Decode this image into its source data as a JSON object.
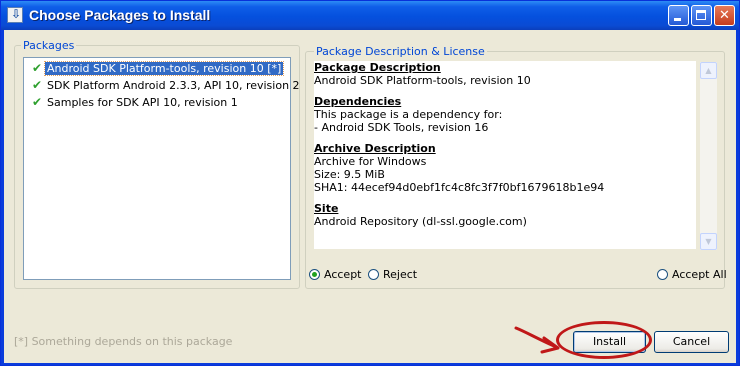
{
  "window": {
    "title": "Choose Packages to Install",
    "icon": "download-arrow-icon",
    "controls": [
      "minimize-icon",
      "maximize-icon",
      "close-icon"
    ]
  },
  "packages": {
    "legend": "Packages",
    "items": [
      {
        "label": "Android SDK Platform-tools, revision 10 [*]",
        "status_icon": "green-check-icon",
        "selected": true
      },
      {
        "label": "SDK Platform Android 2.3.3, API 10, revision 2",
        "status_icon": "green-check-icon",
        "selected": false
      },
      {
        "label": "Samples for SDK API 10, revision 1",
        "status_icon": "green-check-icon",
        "selected": false
      }
    ]
  },
  "description": {
    "legend": "Package Description & License",
    "sections": [
      {
        "heading": "Package Description",
        "lines": [
          "Android SDK Platform-tools, revision 10"
        ]
      },
      {
        "heading": "Dependencies",
        "lines": [
          "This package is a dependency for:",
          "- Android SDK Tools, revision 16"
        ]
      },
      {
        "heading": "Archive Description",
        "lines": [
          "Archive for Windows",
          "Size: 9.5 MiB",
          "SHA1: 44ecef94d0ebf1fc4c8fc3f7f0bf1679618b1e94"
        ]
      },
      {
        "heading": "Site",
        "lines": [
          "Android Repository (dl-ssl.google.com)"
        ]
      }
    ]
  },
  "options": {
    "accept": "Accept",
    "reject": "Reject",
    "accept_all": "Accept All",
    "selected": "accept"
  },
  "footnote": "[*] Something depends on this package",
  "buttons": {
    "install": "Install",
    "cancel": "Cancel"
  },
  "colors": {
    "titlebar": "#0a4bd4",
    "legend_text": "#0046d5",
    "selection": "#316ac5",
    "annotation": "#c01818"
  }
}
